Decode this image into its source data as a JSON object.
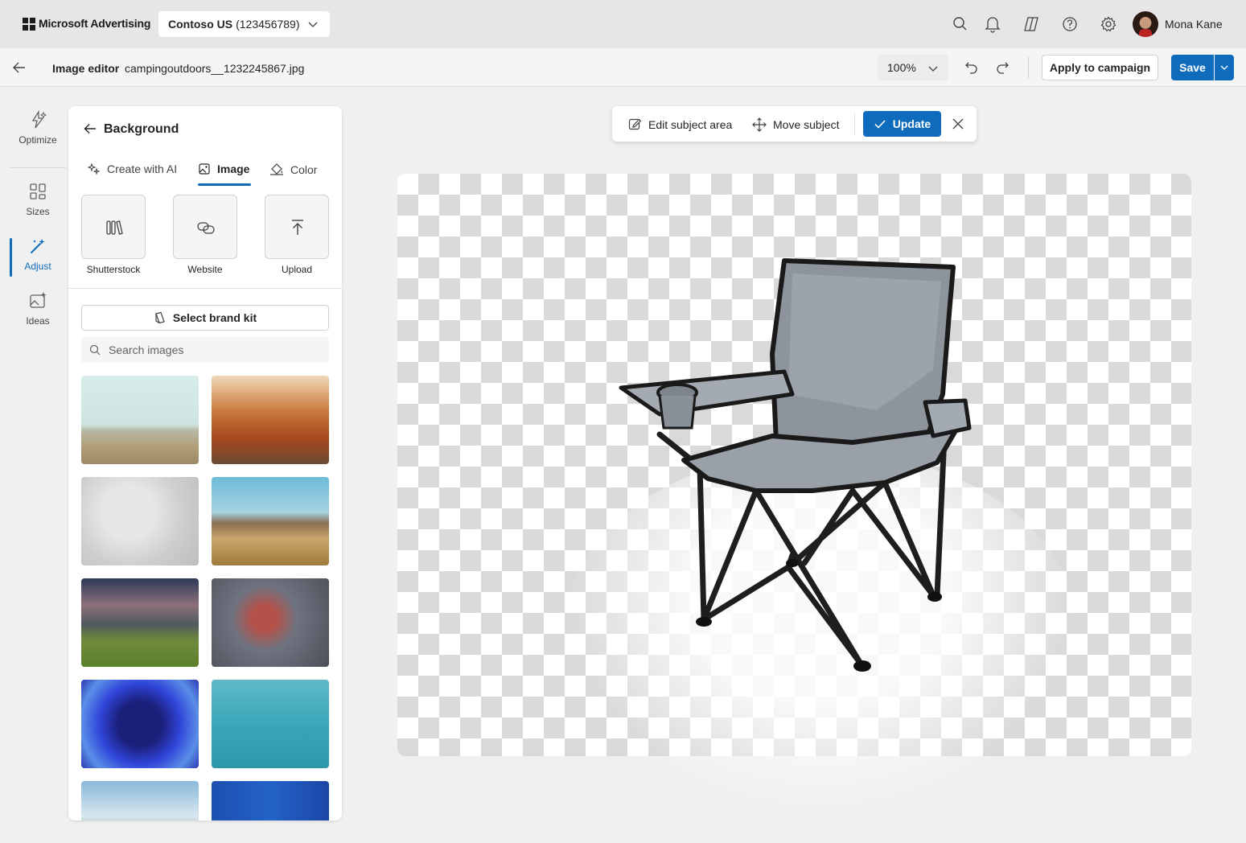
{
  "app": {
    "brand": "Microsoft Advertising",
    "account_name": "Contoso US",
    "account_id": "(123456789)",
    "user_name": "Mona Kane"
  },
  "toolbar": {
    "title": "Image editor",
    "file_name": "campingoutdoors__1232245867.jpg",
    "zoom": "100%",
    "apply_label": "Apply to campaign",
    "save_label": "Save"
  },
  "rail": {
    "items": [
      {
        "label": "Optimize",
        "icon": "optimize-icon"
      },
      {
        "label": "Sizes",
        "icon": "sizes-icon"
      },
      {
        "label": "Adjust",
        "icon": "adjust-icon",
        "active": true
      },
      {
        "label": "Ideas",
        "icon": "ideas-icon"
      }
    ]
  },
  "panel": {
    "title": "Background",
    "tabs": [
      {
        "label": "Create with AI"
      },
      {
        "label": "Image",
        "active": true
      },
      {
        "label": "Color"
      }
    ],
    "sources": [
      {
        "label": "Shutterstock",
        "icon": "library-icon"
      },
      {
        "label": "Website",
        "icon": "link-icon"
      },
      {
        "label": "Upload",
        "icon": "upload-icon"
      }
    ],
    "brand_kit_label": "Select brand kit",
    "search_placeholder": "Search images"
  },
  "canvas_toolbar": {
    "edit_label": "Edit subject area",
    "move_label": "Move subject",
    "update_label": "Update"
  },
  "colors": {
    "accent": "#0f6cbd",
    "topbar": "#e6e6e6",
    "background": "#f0f0f0",
    "checker": "#d9d9d9"
  }
}
